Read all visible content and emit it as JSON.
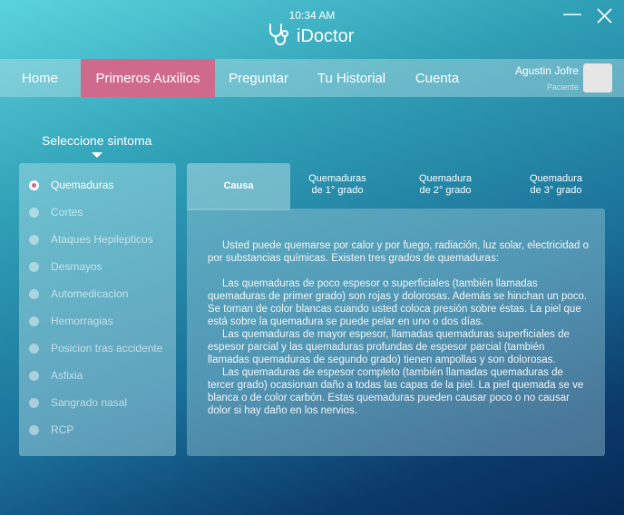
{
  "header": {
    "time": "10:34 AM",
    "app_name": "iDoctor"
  },
  "nav": {
    "home": "Home",
    "first_aid": "Primeros Auxilios",
    "ask": "Preguntar",
    "history": "Tu Historial",
    "account": "Cuenta"
  },
  "user": {
    "name": "Agustin Jofre",
    "role": "Paciente"
  },
  "symptoms": {
    "label": "Seleccione sintoma",
    "selected": "Quemaduras",
    "items": [
      "Quemaduras",
      "Cortes",
      "Ataques Hepilepticos",
      "Desmayos",
      "Automedicacion",
      "Hemorragias",
      "Posicion tras accidente",
      "Asfixia",
      "Sangrado nasal",
      "RCP"
    ]
  },
  "tabs": {
    "active": "Causa",
    "first_a": "Quemaduras",
    "first_b": "de 1° grado",
    "second_a": "Quemadura",
    "second_b": "de 2° grado",
    "third_a": "Quemadura",
    "third_b": "de 3° grado"
  },
  "content": {
    "p1": "Usted puede quemarse por calor y por fuego, radiación, luz solar, electricidad o por substancias químicas. Existen tres grados de quemaduras:",
    "p2": "Las quemaduras de poco espesor o superficiales (también llamadas quemaduras de primer grado) son rojas y dolorosas. Además se hinchan un poco. Se tornan de color blancas cuando usted coloca presión sobre éstas. La piel que está sobre la quemadura se puede pelar en uno o dos días.",
    "p3": "Las quemaduras de mayor espesor, llamadas quemaduras superficiales de espesor parcial y las quemaduras profundas de espesor parcial (también llamadas quemaduras de segundo grado) tienen ampollas y son dolorosas.",
    "p4": "Las quemaduras de espesor completo (también llamadas quemaduras de tercer grado) ocasionan daño a todas las capas de la piel. La piel quemada se ve blanca o de color carbón. Estas quemaduras pueden causar poco o no causar dolor si hay daño en los nervios."
  },
  "colors": {
    "accent": "#d06a8d"
  },
  "icons": {
    "logo": "stethoscope-icon",
    "minimize": "minimize-icon",
    "close": "close-icon"
  }
}
